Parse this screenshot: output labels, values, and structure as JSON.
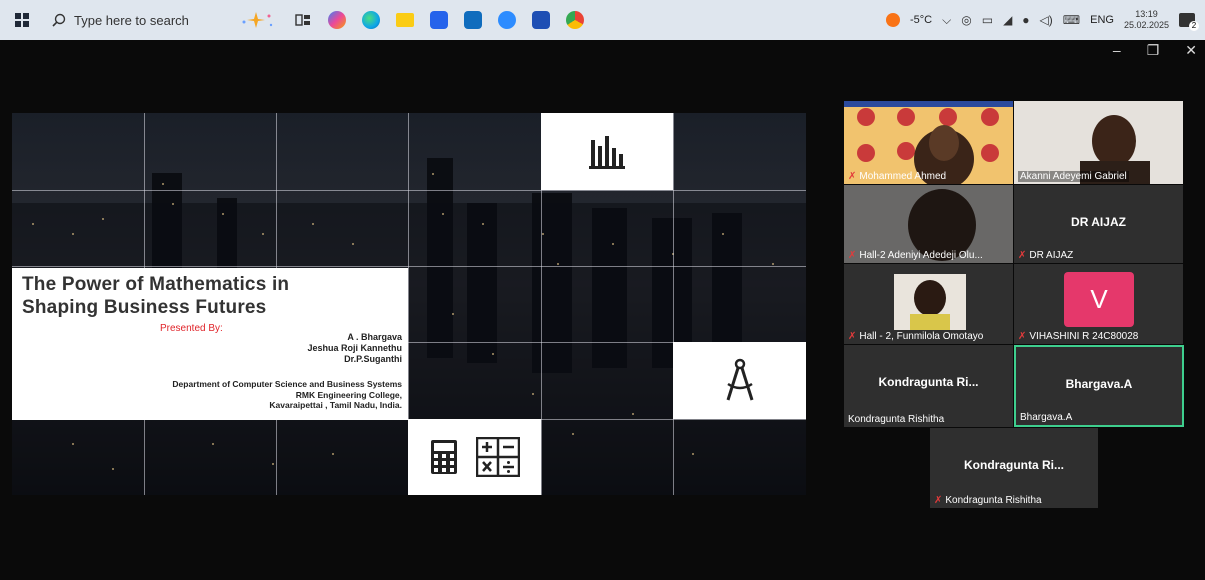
{
  "taskbar": {
    "search_placeholder": "Type here to search",
    "weather": "-5°C",
    "language": "ENG",
    "time": "13:19",
    "date": "25.02.2025",
    "notification_count": "2"
  },
  "slide": {
    "title_line1": "The Power of Mathematics in",
    "title_line2": "Shaping Business Futures",
    "presented_by": "Presented By:",
    "author1": "A . Bhargava",
    "author2": "Jeshua Roji Kannethu",
    "author3": "Dr.P.Suganthi",
    "dept_line1": "Department of Computer Science and Business Systems",
    "dept_line2": "RMK Engineering College,",
    "dept_line3": "Kavaraipettai , Tamil Nadu, India."
  },
  "participants": [
    {
      "name": "Mohammed Ahmed",
      "muted": true
    },
    {
      "name": "Akanni Adeyemi Gabriel",
      "muted": false
    },
    {
      "name": "Hall-2 Adeniyi Adedeji Olu...",
      "muted": true
    },
    {
      "name": "DR AIJAZ",
      "display": "DR AIJAZ",
      "muted": true
    },
    {
      "name": "Hall - 2, Funmilola Omotayo",
      "muted": true
    },
    {
      "name": "VIHASHINI R 24C80028",
      "initial": "V",
      "muted": true
    },
    {
      "name": "Kondragunta Rishitha",
      "display": "Kondragunta  Ri...",
      "muted": false
    },
    {
      "name": "Bhargava.A",
      "display": "Bhargava.A",
      "muted": false
    },
    {
      "name": "Kondragunta Rishitha",
      "display": "Kondragunta  Ri...",
      "muted": true
    }
  ],
  "colors": {
    "taskbar_bg": "#dfe6ee",
    "active_speaker_border": "#3ecf8e",
    "avatar_v": "#e5386b",
    "presented_red": "#e0242a"
  }
}
